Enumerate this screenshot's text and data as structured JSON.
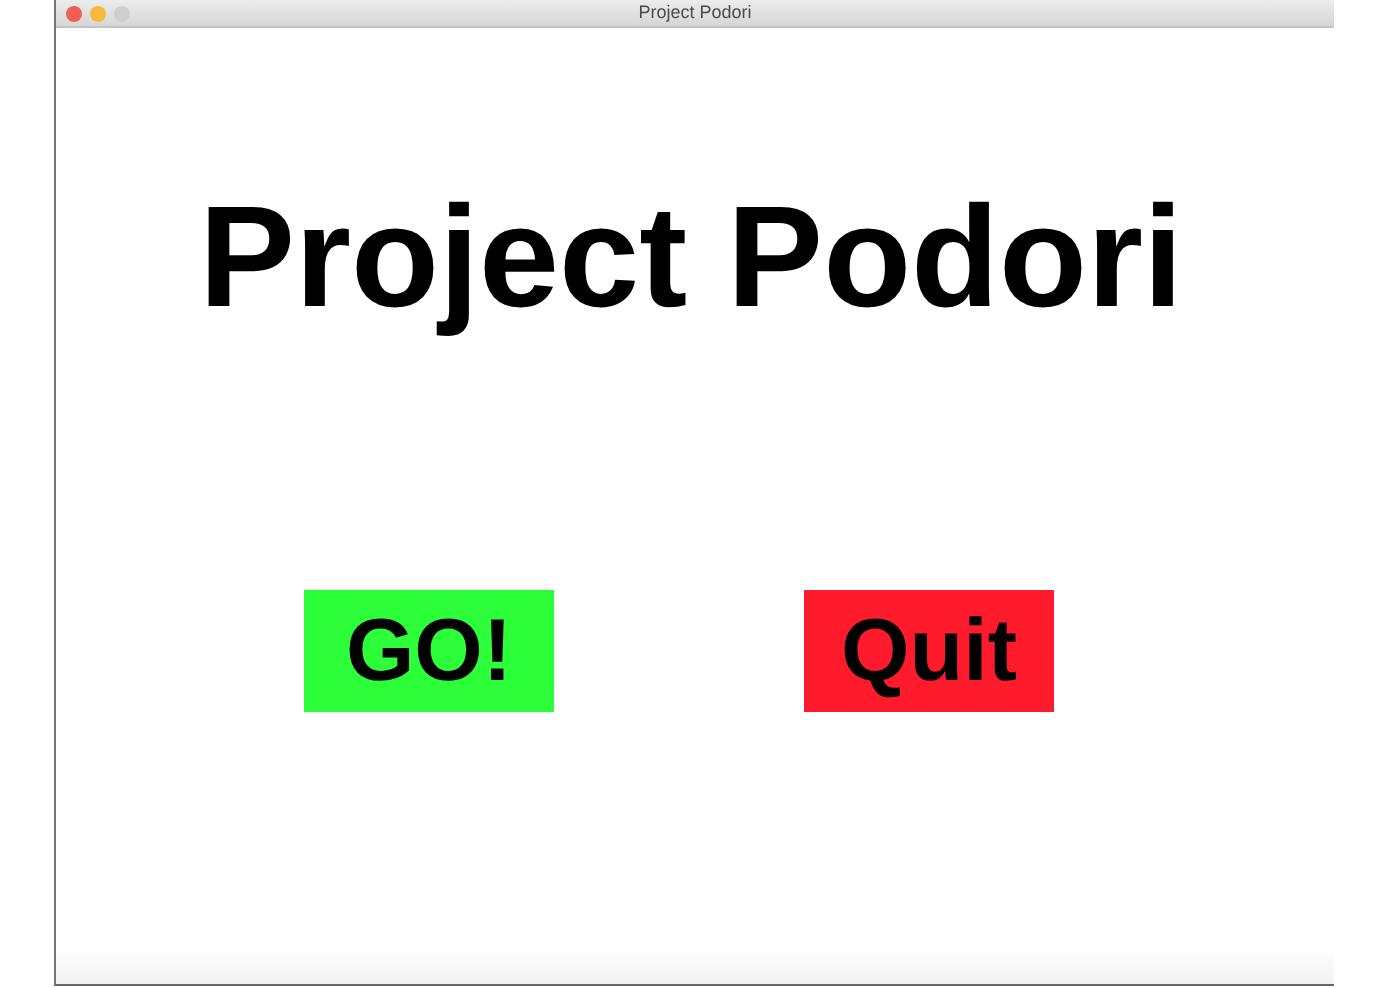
{
  "window": {
    "title": "Project Podori"
  },
  "heading": "Project Podori",
  "buttons": [
    {
      "label": "GO!",
      "color": "#2cff3a"
    },
    {
      "label": "Quit",
      "color": "#ff1a2c"
    }
  ]
}
